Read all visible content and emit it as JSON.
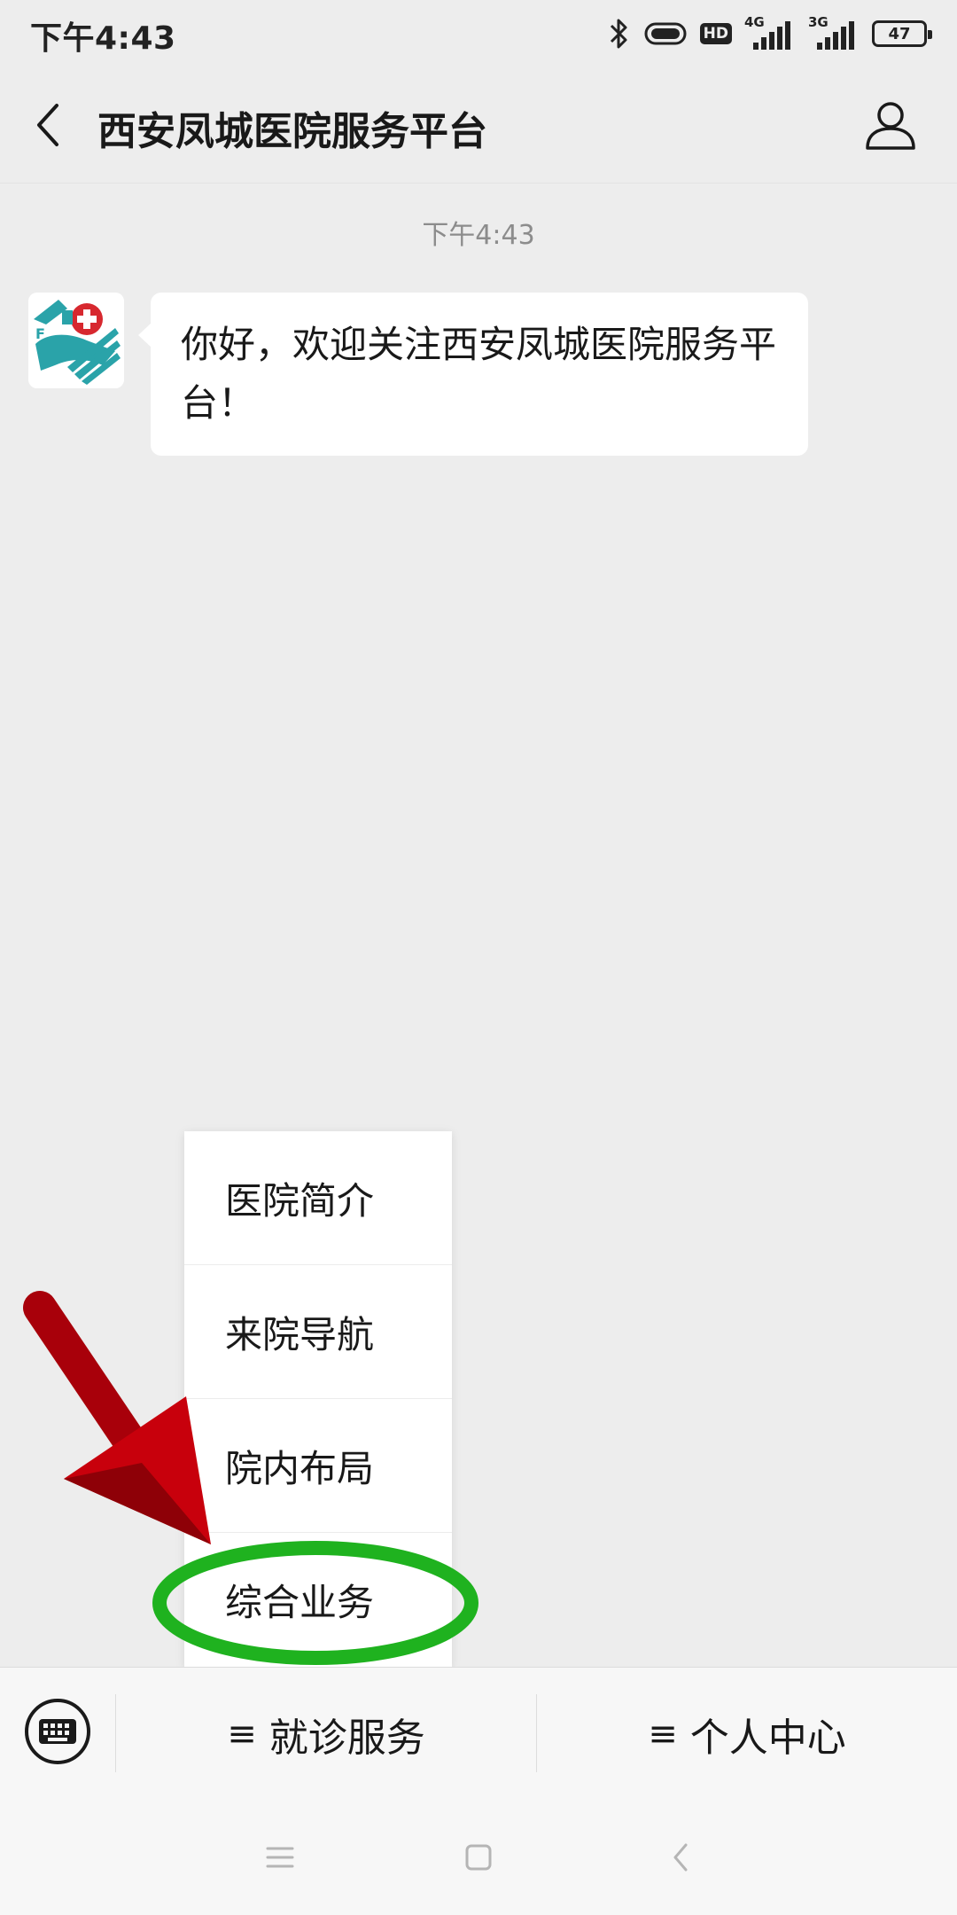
{
  "status_bar": {
    "time": "下午4:43",
    "hd_label": "HD",
    "network_1": "4G",
    "network_2": "3G",
    "battery": "47"
  },
  "nav": {
    "title": "西安凤城医院服务平台",
    "icons": {
      "back": "chevron-left-icon",
      "profile": "person-icon"
    }
  },
  "chat": {
    "timestamp": "下午4:43",
    "message": "你好，欢迎关注西安凤城医院服务平台！"
  },
  "popup_menu": {
    "items": [
      {
        "label": "医院简介"
      },
      {
        "label": "来院导航"
      },
      {
        "label": "院内布局"
      },
      {
        "label": "综合业务"
      }
    ]
  },
  "bottom_menu": {
    "items": [
      {
        "label": "就诊服务"
      },
      {
        "label": "个人中心"
      }
    ]
  },
  "colors": {
    "background": "#ededed",
    "bubble": "#ffffff",
    "arrow": "#b3000a",
    "highlight": "#1fb21f"
  }
}
